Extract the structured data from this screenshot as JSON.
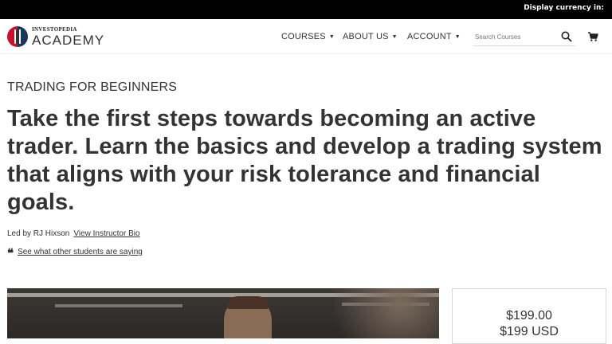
{
  "topbar": {
    "currency_label": "Display currency in:"
  },
  "header": {
    "logo": {
      "sup": "INVESTOPEDIA",
      "main": "ACADEMY"
    },
    "nav": [
      {
        "label": "COURSES"
      },
      {
        "label": "ABOUT US"
      },
      {
        "label": "ACCOUNT"
      }
    ],
    "search": {
      "placeholder": "Search Courses"
    }
  },
  "course": {
    "eyebrow": "TRADING FOR BEGINNERS",
    "headline": "Take the first steps towards becoming an active trader. Learn the basics and develop a trading system that aligns with your risk tolerance and financial goals.",
    "led_by": "Led by RJ Hixson",
    "bio_link": "View Instructor Bio",
    "reviews_link": "See what other students are saying"
  },
  "pricing": {
    "price": "$199.00",
    "price_usd": "$199 USD"
  },
  "colors": {
    "topbar": "#000000",
    "brand_red": "#c8102e",
    "brand_navy": "#1b365d",
    "text": "#333333"
  }
}
